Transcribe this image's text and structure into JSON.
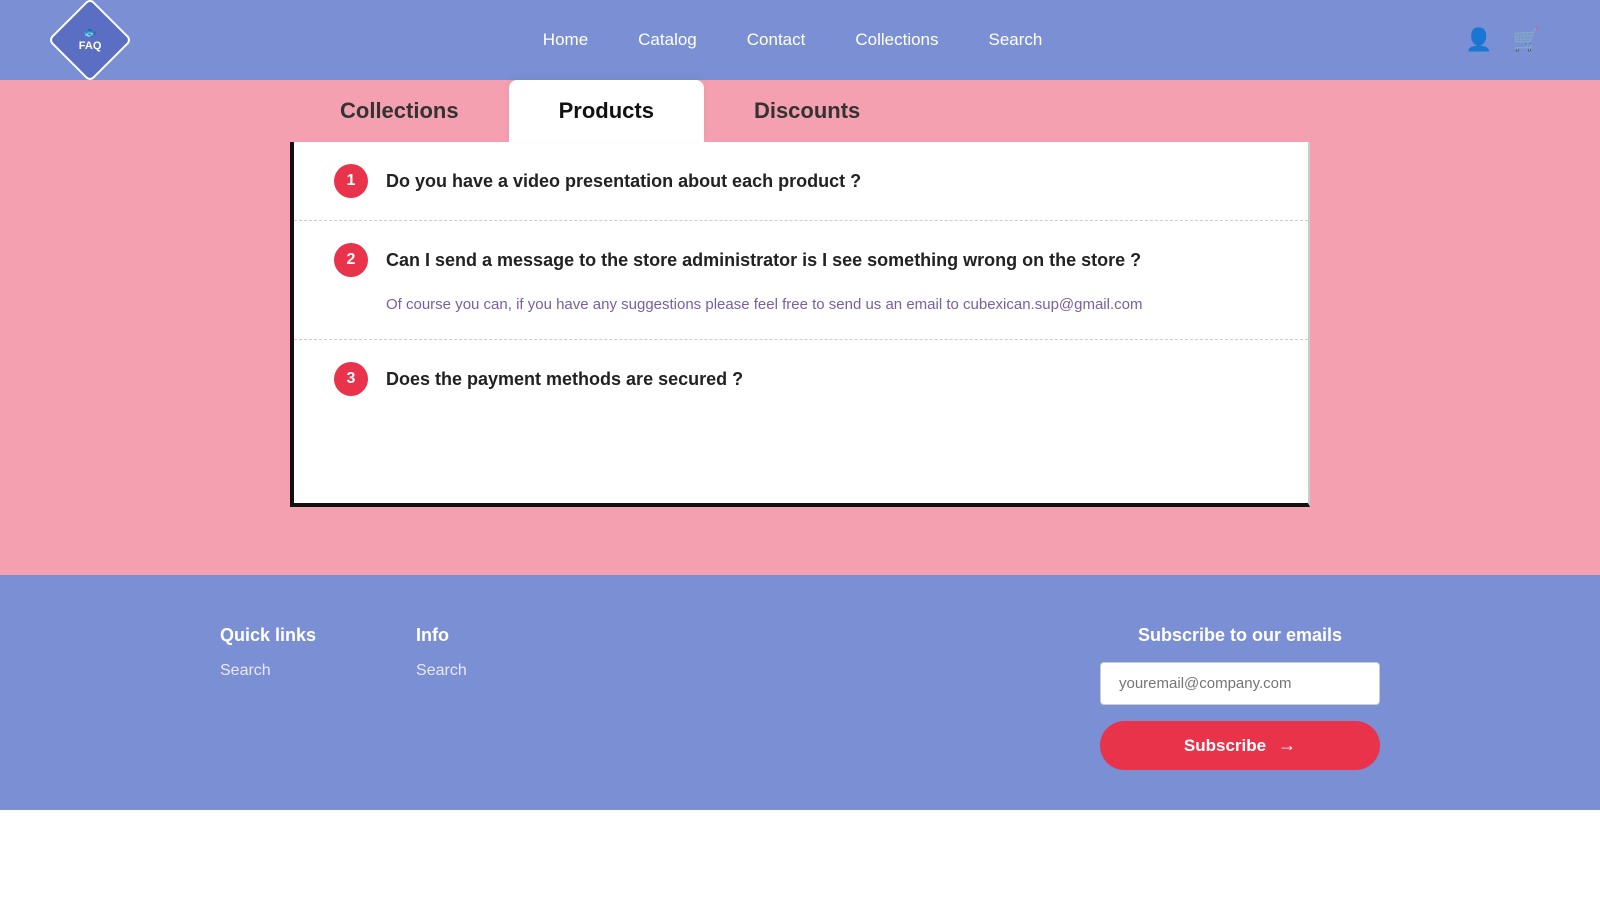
{
  "header": {
    "logo_line1": "FAQ",
    "nav": [
      {
        "label": "Home",
        "id": "home"
      },
      {
        "label": "Catalog",
        "id": "catalog"
      },
      {
        "label": "Contact",
        "id": "contact"
      },
      {
        "label": "Collections",
        "id": "collections"
      },
      {
        "label": "Search",
        "id": "search"
      }
    ]
  },
  "tabs": [
    {
      "label": "Collections",
      "id": "collections",
      "active": false
    },
    {
      "label": "Products",
      "id": "products",
      "active": true
    },
    {
      "label": "Discounts",
      "id": "discounts",
      "active": false
    }
  ],
  "faq_items": [
    {
      "number": "1",
      "question": "Do you have a video presentation about each product ?",
      "answer": null
    },
    {
      "number": "2",
      "question": "Can I send a message to the store administrator is I see something wrong on the store ?",
      "answer": "Of course you can, if you have any suggestions please feel free to send us an email to cubexican.sup@gmail.com"
    },
    {
      "number": "3",
      "question": "Does the payment methods are secured ?",
      "answer": null
    }
  ],
  "footer": {
    "quick_links_title": "Quick links",
    "quick_links": [
      {
        "label": "Search"
      }
    ],
    "info_title": "Info",
    "info_links": [
      {
        "label": "Search"
      }
    ],
    "subscribe_title": "Subscribe to our emails",
    "email_placeholder": "youremail@company.com",
    "subscribe_label": "Subscribe"
  }
}
